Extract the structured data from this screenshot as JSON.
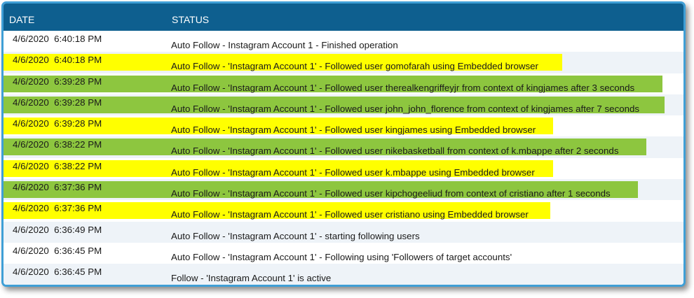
{
  "columns": {
    "date": "DATE",
    "status": "STATUS"
  },
  "colors": {
    "header": "#0e5f8f",
    "border": "#3f9fd6",
    "yellow_highlight": "#ffff00",
    "green_highlight": "#8dc63f"
  },
  "rows": [
    {
      "date": "4/6/2020  6:40:18 PM",
      "status": "Auto Follow - Instagram Account 1 - Finished operation",
      "highlight": "none"
    },
    {
      "date": "4/6/2020  6:40:18 PM",
      "status": "Auto Follow - 'Instagram Account 1' - Followed user gomofarah using Embedded browser",
      "highlight": "yellow"
    },
    {
      "date": "4/6/2020  6:39:28 PM",
      "status": "Auto Follow - 'Instagram Account 1' - Followed user therealkengriffeyjr from context of kingjames after 3 seconds",
      "highlight": "green"
    },
    {
      "date": "4/6/2020  6:39:28 PM",
      "status": "Auto Follow - 'Instagram Account 1' - Followed user john_john_florence from context of kingjames after 7 seconds",
      "highlight": "green"
    },
    {
      "date": "4/6/2020  6:39:28 PM",
      "status": "Auto Follow - 'Instagram Account 1' - Followed user kingjames using Embedded browser",
      "highlight": "yellow"
    },
    {
      "date": "4/6/2020  6:38:22 PM",
      "status": "Auto Follow - 'Instagram Account 1' - Followed user nikebasketball from context of k.mbappe after 2 seconds",
      "highlight": "green"
    },
    {
      "date": "4/6/2020  6:38:22 PM",
      "status": "Auto Follow - 'Instagram Account 1' - Followed user k.mbappe using Embedded browser",
      "highlight": "yellow"
    },
    {
      "date": "4/6/2020  6:37:36 PM",
      "status": "Auto Follow - 'Instagram Account 1' - Followed user kipchogeeliud from context of cristiano after 1 seconds",
      "highlight": "green"
    },
    {
      "date": "4/6/2020  6:37:36 PM",
      "status": "Auto Follow - 'Instagram Account 1' - Followed user cristiano using Embedded browser",
      "highlight": "yellow"
    },
    {
      "date": "4/6/2020  6:36:49 PM",
      "status": "Auto Follow - 'Instagram Account 1' - starting following users",
      "highlight": "none"
    },
    {
      "date": "4/6/2020  6:36:45 PM",
      "status": "Auto Follow - 'Instagram Account 1' - Following using 'Followers of target accounts'",
      "highlight": "none"
    },
    {
      "date": "4/6/2020  6:36:45 PM",
      "status": "Follow - 'Instagram Account 1' is active",
      "highlight": "none"
    }
  ]
}
